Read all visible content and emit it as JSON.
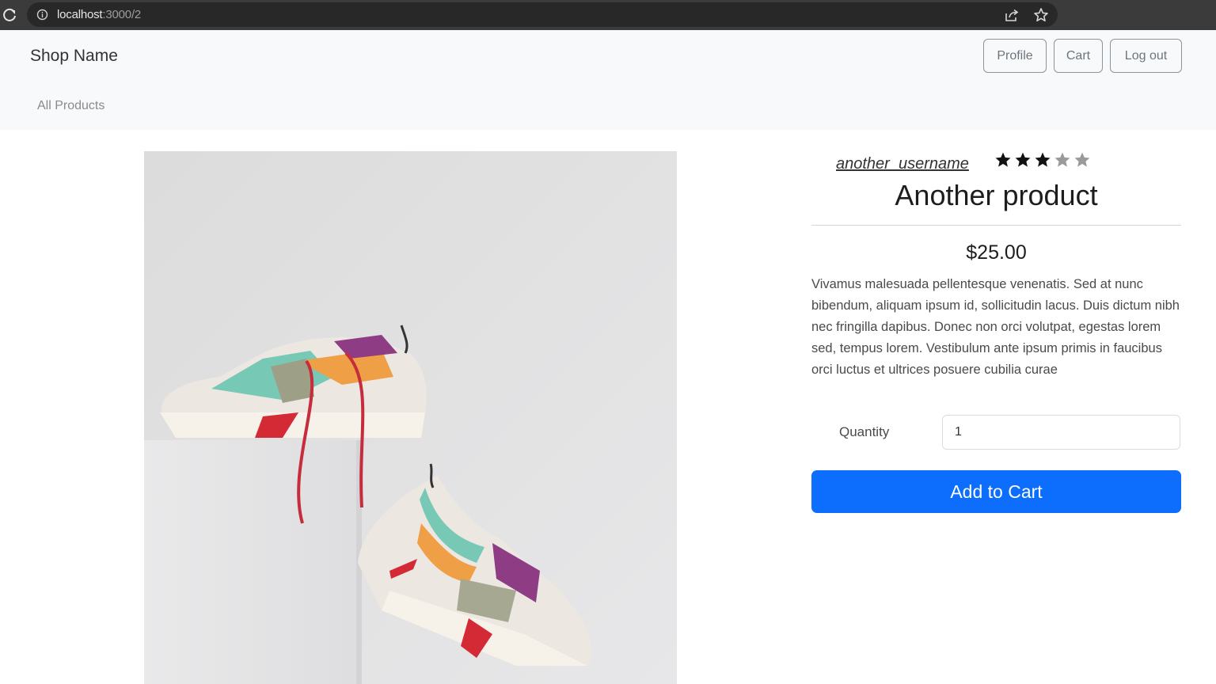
{
  "browser": {
    "url_host": "localhost",
    "url_path": ":3000/2",
    "icons": [
      "reload-icon",
      "site-info-icon",
      "share-icon",
      "bookmark-star-icon"
    ]
  },
  "navbar": {
    "brand": "Shop Name",
    "links": {
      "all_products": "All Products"
    },
    "buttons": {
      "profile": "Profile",
      "cart": "Cart",
      "logout": "Log out"
    }
  },
  "product": {
    "seller": "another_username",
    "rating": {
      "value": 3,
      "max": 5
    },
    "title": "Another product",
    "price": "$25.00",
    "description": "Vivamus malesuada pellentesque venenatis. Sed at nunc bibendum, aliquam ipsum id, sollicitudin lacus. Duis dictum nibh nec fringilla dapibus. Donec non orci volutpat, egestas lorem sed, tempus lorem. Vestibulum ante ipsum primis in faucibus orci luctus et ultrices posuere cubilia curae",
    "quantity_label": "Quantity",
    "quantity_value": "1",
    "add_to_cart_label": "Add to Cart"
  },
  "colors": {
    "primary": "#0d6efd",
    "navbar_bg": "#f8f9fa",
    "star_filled": "#111111",
    "star_empty": "#9a9a9a"
  }
}
